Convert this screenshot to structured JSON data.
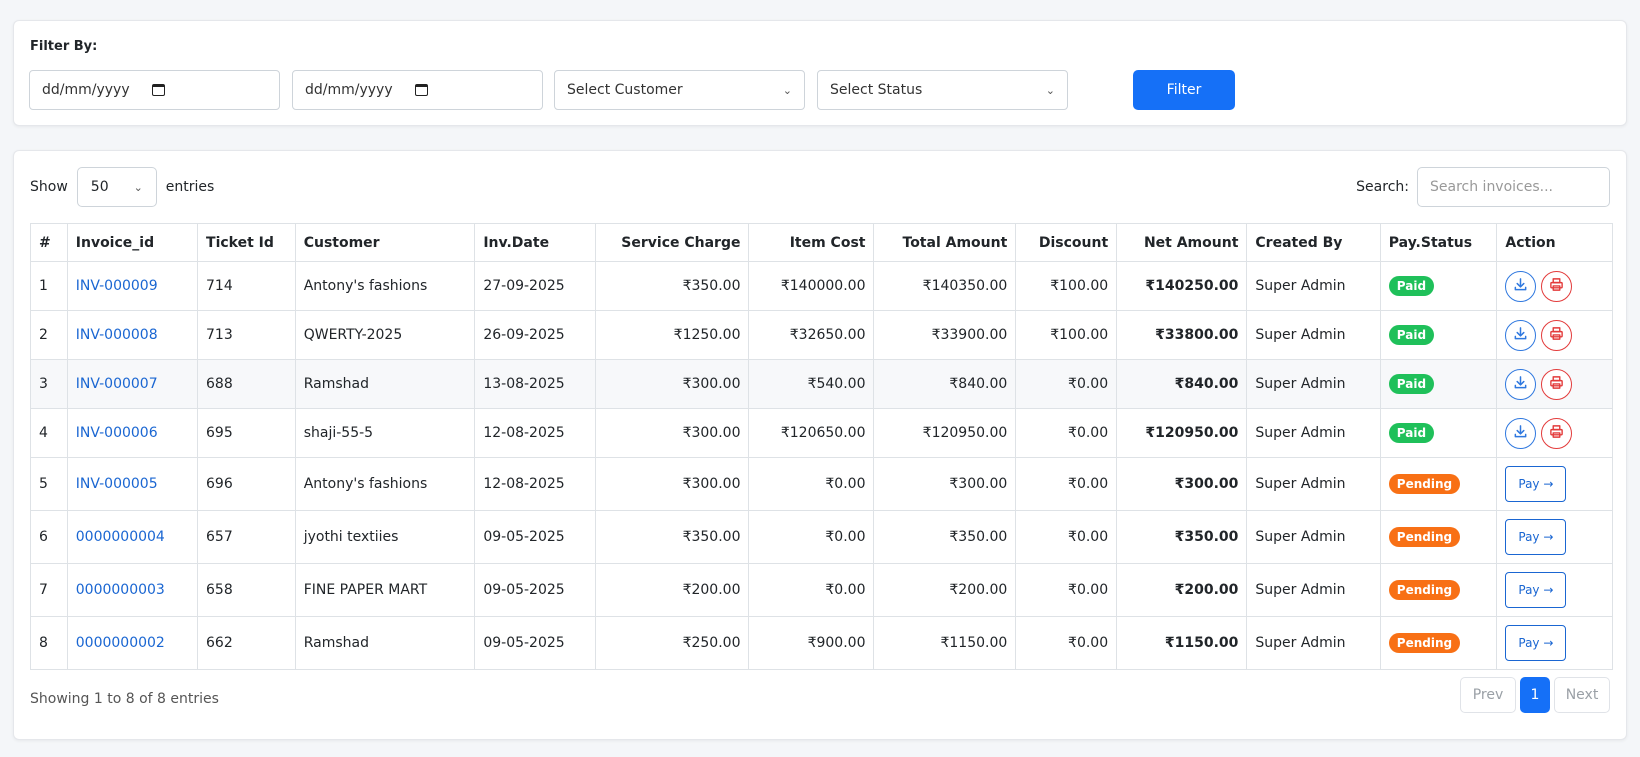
{
  "filter": {
    "title": "Filter By:",
    "date_from_placeholder": "dd/mm/yyyy",
    "date_to_placeholder": "dd/mm/yyyy",
    "customer_select": "Select Customer",
    "status_select": "Select Status",
    "button_label": "Filter"
  },
  "table_controls": {
    "show_label": "Show",
    "page_length": "50",
    "entries_label": "entries",
    "search_label": "Search:",
    "search_placeholder": "Search invoices..."
  },
  "columns": [
    "#",
    "Invoice_id",
    "Ticket Id",
    "Customer",
    "Inv.Date",
    "Service Charge",
    "Item Cost",
    "Total Amount",
    "Discount",
    "Net Amount",
    "Created By",
    "Pay.Status",
    "Action"
  ],
  "rows": [
    {
      "num": "1",
      "invoice_id": "INV-000009",
      "ticket_id": "714",
      "customer": "Antony's fashions",
      "date": "27-09-2025",
      "service": "₹350.00",
      "item": "₹140000.00",
      "total": "₹140350.00",
      "discount": "₹100.00",
      "net": "₹140250.00",
      "created_by": "Super Admin",
      "status": "Paid"
    },
    {
      "num": "2",
      "invoice_id": "INV-000008",
      "ticket_id": "713",
      "customer": "QWERTY-2025",
      "date": "26-09-2025",
      "service": "₹1250.00",
      "item": "₹32650.00",
      "total": "₹33900.00",
      "discount": "₹100.00",
      "net": "₹33800.00",
      "created_by": "Super Admin",
      "status": "Paid"
    },
    {
      "num": "3",
      "invoice_id": "INV-000007",
      "ticket_id": "688",
      "customer": "Ramshad",
      "date": "13-08-2025",
      "service": "₹300.00",
      "item": "₹540.00",
      "total": "₹840.00",
      "discount": "₹0.00",
      "net": "₹840.00",
      "created_by": "Super Admin",
      "status": "Paid"
    },
    {
      "num": "4",
      "invoice_id": "INV-000006",
      "ticket_id": "695",
      "customer": "shaji-55-5",
      "date": "12-08-2025",
      "service": "₹300.00",
      "item": "₹120650.00",
      "total": "₹120950.00",
      "discount": "₹0.00",
      "net": "₹120950.00",
      "created_by": "Super Admin",
      "status": "Paid"
    },
    {
      "num": "5",
      "invoice_id": "INV-000005",
      "ticket_id": "696",
      "customer": "Antony's fashions",
      "date": "12-08-2025",
      "service": "₹300.00",
      "item": "₹0.00",
      "total": "₹300.00",
      "discount": "₹0.00",
      "net": "₹300.00",
      "created_by": "Super Admin",
      "status": "Pending"
    },
    {
      "num": "6",
      "invoice_id": "0000000004",
      "ticket_id": "657",
      "customer": "jyothi textiies",
      "date": "09-05-2025",
      "service": "₹350.00",
      "item": "₹0.00",
      "total": "₹350.00",
      "discount": "₹0.00",
      "net": "₹350.00",
      "created_by": "Super Admin",
      "status": "Pending"
    },
    {
      "num": "7",
      "invoice_id": "0000000003",
      "ticket_id": "658",
      "customer": "FINE PAPER MART",
      "date": "09-05-2025",
      "service": "₹200.00",
      "item": "₹0.00",
      "total": "₹200.00",
      "discount": "₹0.00",
      "net": "₹200.00",
      "created_by": "Super Admin",
      "status": "Pending"
    },
    {
      "num": "8",
      "invoice_id": "0000000002",
      "ticket_id": "662",
      "customer": "Ramshad",
      "date": "09-05-2025",
      "service": "₹250.00",
      "item": "₹900.00",
      "total": "₹1150.00",
      "discount": "₹0.00",
      "net": "₹1150.00",
      "created_by": "Super Admin",
      "status": "Pending"
    }
  ],
  "pay_button_label": "Pay →",
  "icons": {
    "download": "download-icon",
    "print": "printer-icon",
    "chevron": "chevron-down-icon",
    "calendar": "calendar-icon"
  },
  "colors": {
    "primary": "#1570f7",
    "link": "#1a66d2",
    "paid": "#1fc05a",
    "pending": "#f87015",
    "print": "#e33b3b"
  },
  "footer": {
    "info": "Showing 1 to 8 of 8 entries",
    "prev": "Prev",
    "current_page": "1",
    "next": "Next"
  }
}
